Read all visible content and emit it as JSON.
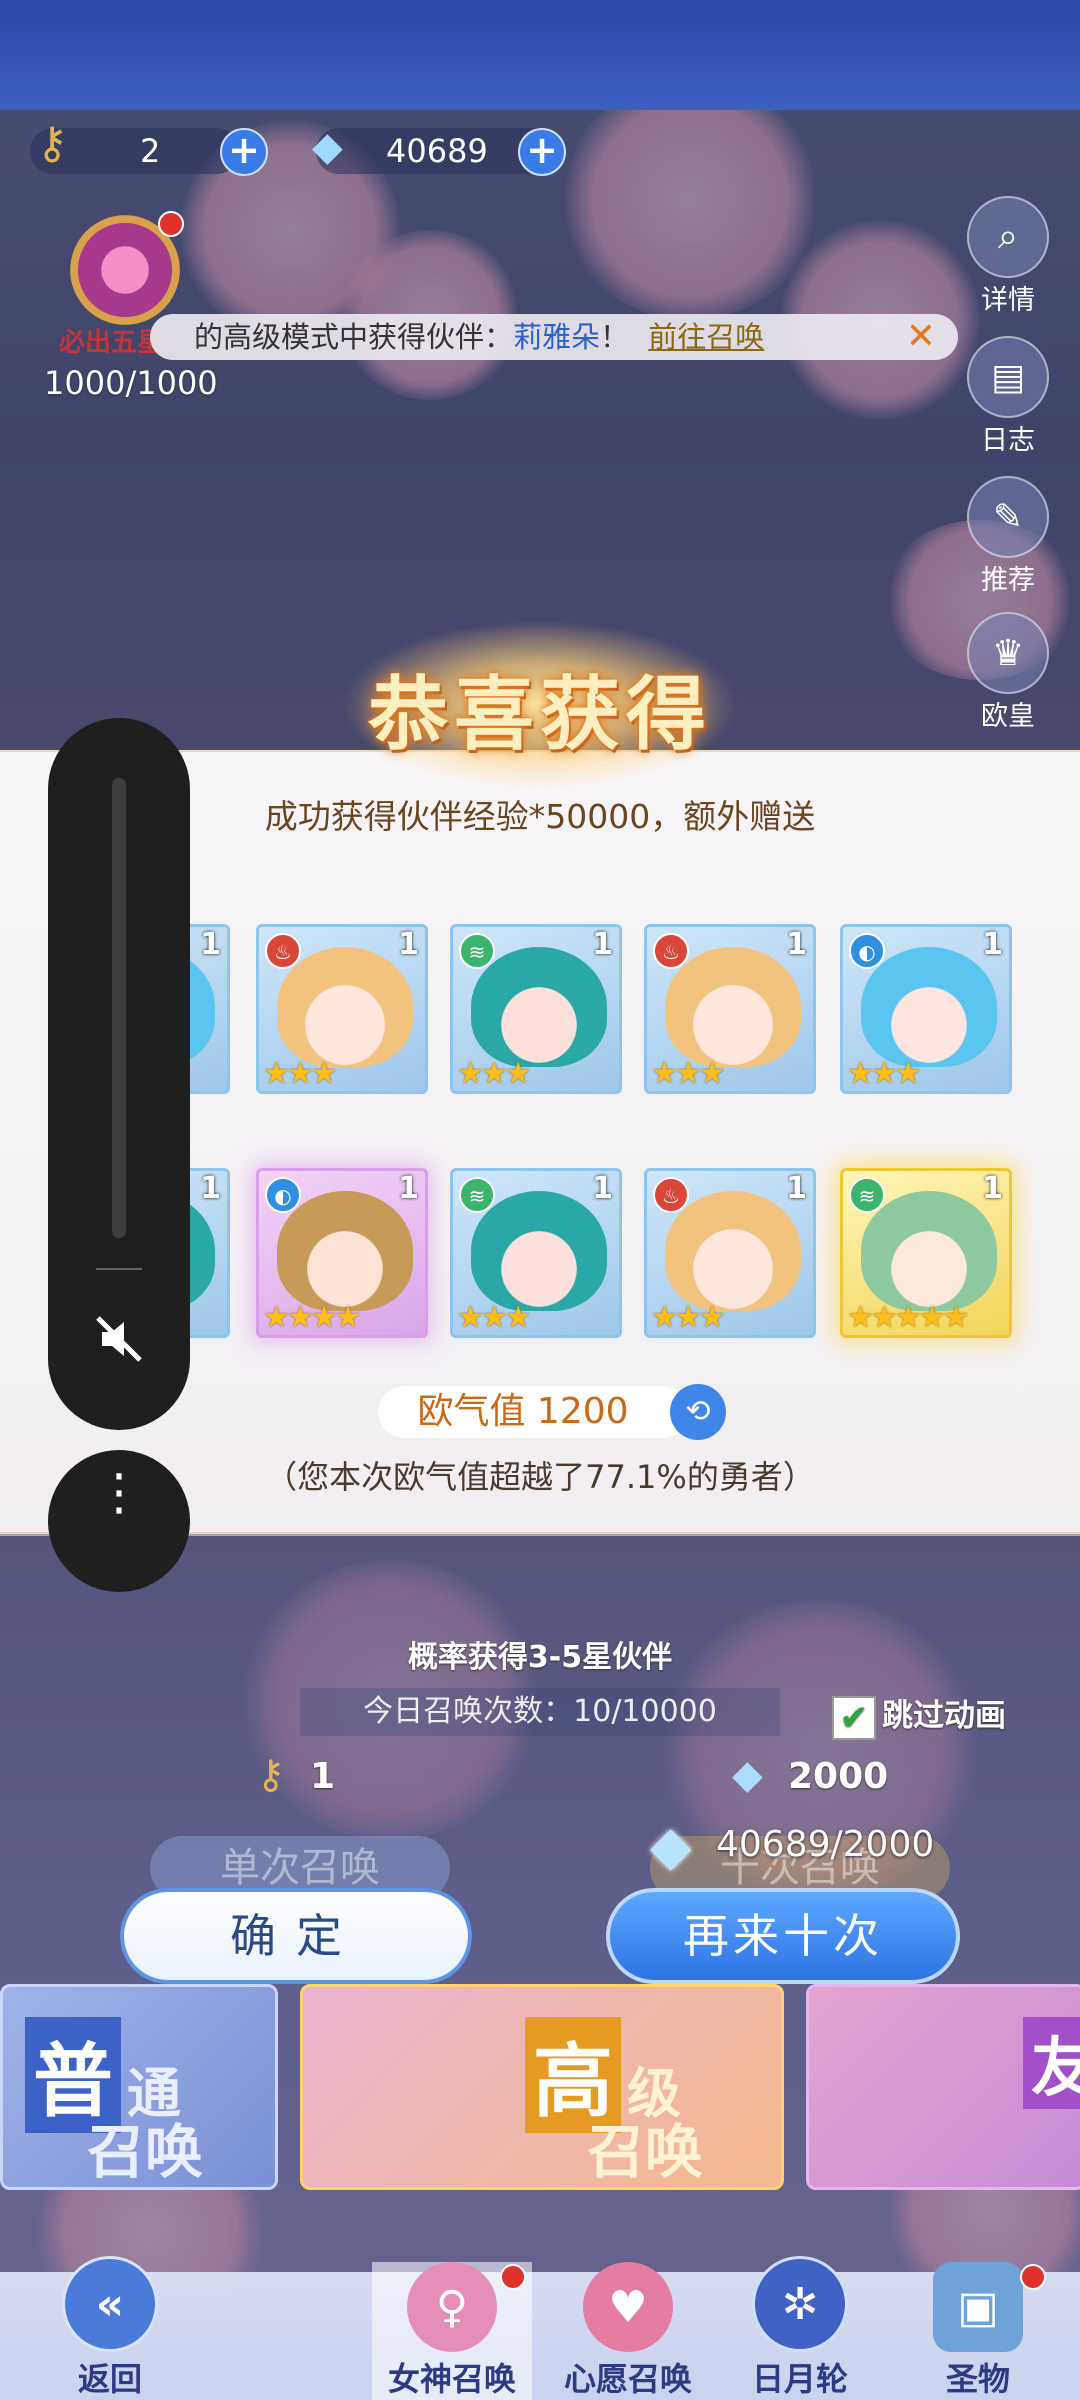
{
  "currency": {
    "keys": "2",
    "crystals": "40689"
  },
  "guarantee": {
    "label": "必出五星",
    "progress": "1000/1000",
    "progress_fraction": 1.0
  },
  "side_buttons": [
    {
      "label": "详情",
      "icon": "magnifier-icon"
    },
    {
      "label": "日志",
      "icon": "book-icon"
    },
    {
      "label": "推荐",
      "icon": "feather-icon"
    },
    {
      "label": "欧皇",
      "icon": "crown-icon"
    }
  ],
  "notice": {
    "text": "的高级模式中获得伙伴：",
    "name": "莉雅朵",
    "bang": "！",
    "link": "前往召唤",
    "close": "✕"
  },
  "result": {
    "title": "恭喜获得",
    "subtitle": "成功获得伙伴经验*50000，额外赠送",
    "row1": [
      {
        "count": "1",
        "element": "",
        "stars": 3,
        "hair": "blue",
        "partial": true
      },
      {
        "count": "1",
        "element": "fire",
        "stars": 3,
        "hair": "blonde"
      },
      {
        "count": "1",
        "element": "wind",
        "stars": 3,
        "hair": "teal"
      },
      {
        "count": "1",
        "element": "fire",
        "stars": 3,
        "hair": "blonde"
      },
      {
        "count": "1",
        "element": "water",
        "stars": 3,
        "hair": "blue"
      }
    ],
    "row2": [
      {
        "count": "1",
        "element": "",
        "stars": 3,
        "hair": "teal",
        "partial": true
      },
      {
        "count": "1",
        "element": "water",
        "stars": 4,
        "hair": "brown",
        "rarity": "purple"
      },
      {
        "count": "1",
        "element": "wind",
        "stars": 3,
        "hair": "teal"
      },
      {
        "count": "1",
        "element": "fire",
        "stars": 3,
        "hair": "blonde"
      },
      {
        "count": "1",
        "element": "wind",
        "stars": 5,
        "hair": "green",
        "rarity": "gold"
      }
    ],
    "luck_label": "欧气值",
    "luck_value": "1200",
    "luck_desc": "（您本次欧气值超越了77.1%的勇者）"
  },
  "summon": {
    "probability": "概率获得3-5星伙伴",
    "today": "今日召唤次数：10/10000",
    "skip": "跳过动画",
    "single_cost": "1",
    "ten_cost": "2000",
    "single_label": "单次召唤",
    "ten_label": "十次召唤",
    "crystal_status": "40689/2000",
    "confirm": "确定",
    "again": "再来十次"
  },
  "banners": [
    {
      "line1": "普",
      "line1b": "通",
      "line2": "召唤"
    },
    {
      "line1": "高",
      "line1b": "级",
      "line2": "召唤"
    },
    {
      "line1": "友",
      "line1b": "",
      "line2": ""
    }
  ],
  "nav": [
    {
      "label": "返回",
      "icon": "back-arrow-icon"
    },
    {
      "label": "女神召唤",
      "icon": "goddess-icon"
    },
    {
      "label": "心愿召唤",
      "icon": "heart-icon"
    },
    {
      "label": "日月轮",
      "icon": "wheel-icon"
    },
    {
      "label": "圣物",
      "icon": "relic-icon"
    }
  ],
  "colors": {
    "accent": "#3f86e8",
    "gold": "#f1c53a",
    "star": "#ffbe1a",
    "title_glow": "#e8892b"
  }
}
